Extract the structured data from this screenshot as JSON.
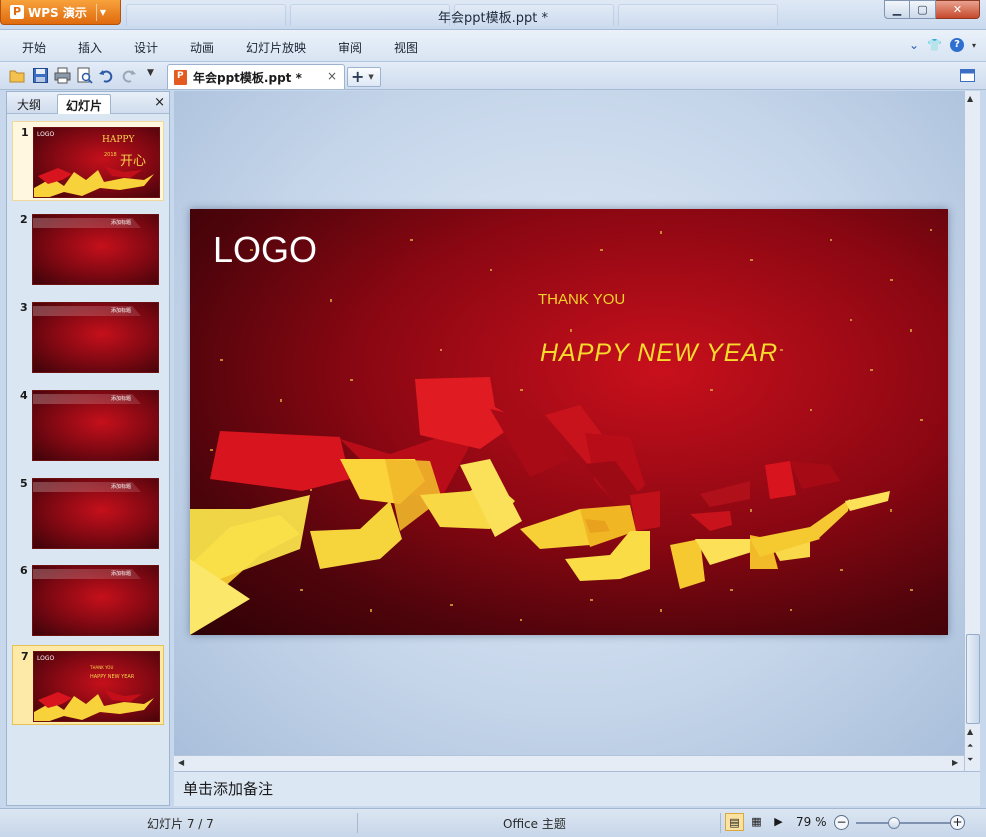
{
  "app": {
    "button_label": "WPS 演示",
    "logo_glyph": "P",
    "window_title": "年会ppt模板.ppt *",
    "accent_color": "#e8741a"
  },
  "window_controls": {
    "minimize": "▭",
    "maximize": "❐",
    "close": "✕"
  },
  "menu": {
    "items": [
      "开始",
      "插入",
      "设计",
      "动画",
      "幻灯片放映",
      "审阅",
      "视图"
    ]
  },
  "document_tab": {
    "name": "年会ppt模板.ppt *",
    "close": "×"
  },
  "side_panel": {
    "tabs": [
      "大纲",
      "幻灯片"
    ],
    "active_tab": "幻灯片",
    "close": "×",
    "slides": [
      {
        "num": "1",
        "type": "title",
        "logo": "LOGO",
        "title": "HAPPY",
        "sub": "2018",
        "big": "开心"
      },
      {
        "num": "2",
        "type": "content",
        "header": "添加标题"
      },
      {
        "num": "3",
        "type": "content",
        "header": "添加标题"
      },
      {
        "num": "4",
        "type": "content",
        "header": "添加标题"
      },
      {
        "num": "5",
        "type": "content",
        "header": "添加标题"
      },
      {
        "num": "6",
        "type": "content",
        "header": "添加标题"
      },
      {
        "num": "7",
        "type": "end",
        "logo": "LOGO",
        "thanks": "THANK YOU",
        "hny": "HAPPY NEW YEAR"
      }
    ],
    "active_slide": "7"
  },
  "slide": {
    "logo": "LOGO",
    "thank_you": "THANK YOU",
    "greeting": "HAPPY NEW YEAR",
    "bg_color": "#8a0712",
    "text_color": "#f7dc2e"
  },
  "notes": {
    "placeholder": "单击添加备注"
  },
  "status": {
    "slide_counter": "幻灯片 7 / 7",
    "theme": "Office 主题",
    "zoom": "79 %",
    "zoom_level_percent": 79
  }
}
